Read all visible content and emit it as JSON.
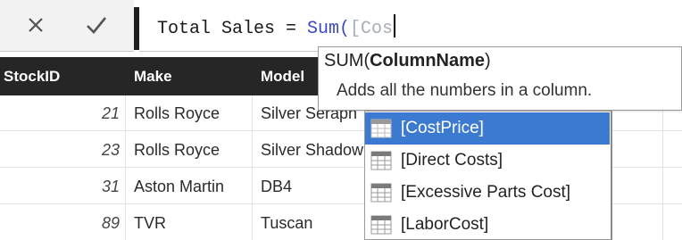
{
  "formula_bar": {
    "cancel_icon": "close-icon",
    "commit_icon": "checkmark-icon",
    "formula_prefix": "Total Sales = ",
    "formula_function": "Sum(",
    "formula_argument": "[Cos"
  },
  "table": {
    "columns": [
      "StockID",
      "Make",
      "Model"
    ],
    "rows": [
      {
        "stockid": "21",
        "make": "Rolls Royce",
        "model": "Silver Seraph"
      },
      {
        "stockid": "23",
        "make": "Rolls Royce",
        "model": "Silver Shadow"
      },
      {
        "stockid": "31",
        "make": "Aston Martin",
        "model": "DB4"
      },
      {
        "stockid": "89",
        "make": "TVR",
        "model": "Tuscan"
      }
    ]
  },
  "tooltip": {
    "function_name": "SUM(",
    "parameter": "ColumnName",
    "close_paren": ")",
    "description": "Adds all the numbers in a column."
  },
  "autocomplete": {
    "items": [
      {
        "label": "[CostPrice]",
        "icon": "column-icon"
      },
      {
        "label": "[Direct Costs]",
        "icon": "column-icon"
      },
      {
        "label": "[Excessive Parts Cost]",
        "icon": "column-icon"
      },
      {
        "label": "[LaborCost]",
        "icon": "column-icon"
      }
    ],
    "selected_index": 0
  },
  "colors": {
    "header_bg": "#262626",
    "selection": "#3b7ad0",
    "function_text": "#3a48c9"
  }
}
